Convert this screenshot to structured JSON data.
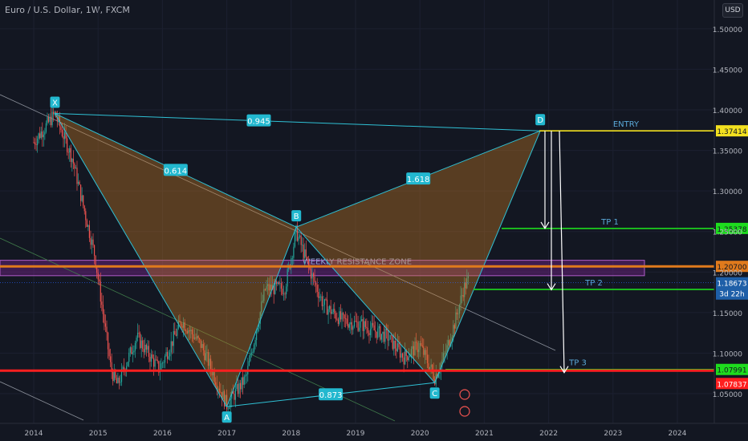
{
  "chart_data": {
    "type": "candlestick",
    "title": "Euro / U.S. Dollar, 1W, FXCM",
    "currency_button": "USD",
    "x_ticks": [
      "2014",
      "2015",
      "2016",
      "2017",
      "2018",
      "2019",
      "2020",
      "2021",
      "2022",
      "2023",
      "2024"
    ],
    "y_ticks": [
      "1.50000",
      "1.45000",
      "1.40000",
      "1.35000",
      "1.30000",
      "1.25000",
      "1.20000",
      "1.15000",
      "1.10000",
      "1.05000"
    ],
    "ylim": [
      1.023,
      1.52
    ],
    "pattern": {
      "points": [
        {
          "label": "X",
          "date": 2014.33,
          "price": 1.3955
        },
        {
          "label": "A",
          "date": 2017.0,
          "price": 1.034
        },
        {
          "label": "B",
          "date": 2018.08,
          "price": 1.2555
        },
        {
          "label": "C",
          "date": 2020.23,
          "price": 1.0636
        },
        {
          "label": "D",
          "date": 2021.87,
          "price": 1.3741
        }
      ],
      "ratios": [
        {
          "from": "X",
          "to": "D",
          "value": "0.945"
        },
        {
          "from": "X",
          "to": "B",
          "value": "0.614"
        },
        {
          "from": "A",
          "to": "C",
          "value": "0.873"
        },
        {
          "from": "B",
          "to": "D",
          "value": "1.618"
        }
      ]
    },
    "levels": [
      {
        "name": "ENTRY",
        "price": 1.37414,
        "color": "#f2e01f",
        "badge": "1.37414"
      },
      {
        "name": "TP 1",
        "price": 1.25378,
        "color": "#1edc1e",
        "badge": "1.25378"
      },
      {
        "name": "TP 2",
        "price": 1.17855,
        "color": "#1edc1e",
        "badge": "1.17855"
      },
      {
        "name": "TP 3",
        "price": 1.07991,
        "color": "#1edc1e",
        "badge": "1.07991"
      },
      {
        "name": "",
        "price": 1.207,
        "color": "#e07a1c",
        "badge": "1.20700"
      },
      {
        "name": "",
        "price": 1.07837,
        "color": "#ff1f1f",
        "badge": "1.07837"
      }
    ],
    "current_price": {
      "value": "1.18673",
      "timer": "3d 22h"
    },
    "zone_label": "WEEKLY RESISTANCE ZONE",
    "zone": [
      1.1955,
      1.2145
    ]
  }
}
